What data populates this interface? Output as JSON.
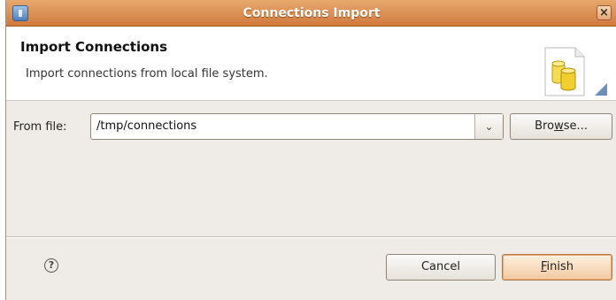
{
  "window": {
    "title": "Connections Import",
    "close_glyph": "×"
  },
  "header": {
    "title": "Import Connections",
    "description": "Import connections from local file system.",
    "icon": "database-import-icon"
  },
  "form": {
    "from_file_label": "From file:",
    "from_file_value": "/tmp/connections",
    "dropdown_glyph": "⌄",
    "browse": {
      "before": "Bro",
      "mnemonic": "w",
      "after": "se..."
    }
  },
  "footer": {
    "help_glyph": "?",
    "cancel_label": "Cancel",
    "finish": {
      "mnemonic": "F",
      "after": "inish"
    }
  },
  "colors": {
    "titlebar": "#d88a50",
    "dialog_bg": "#efebe7",
    "finish_bg": "#f6d8b8"
  }
}
